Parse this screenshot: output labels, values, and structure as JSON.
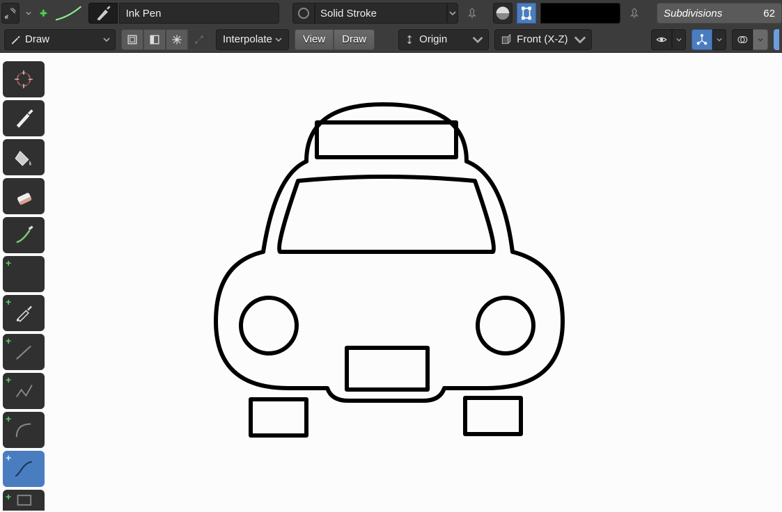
{
  "brush": {
    "name": "Ink Pen"
  },
  "material": {
    "name": "Solid Stroke"
  },
  "subdivisions": {
    "label": "Subdivisions",
    "value": "62"
  },
  "mode": {
    "label": "Draw"
  },
  "interpolate": {
    "label": "Interpolate"
  },
  "viewdraw": {
    "view": "View",
    "draw": "Draw"
  },
  "stroke_placement": {
    "origin": "Origin",
    "plane": "Front (X-Z)"
  },
  "toolbar": {
    "cursor": "cursor-tool",
    "draw": "draw-tool",
    "fill": "fill-tool",
    "erase": "erase-tool",
    "tint": "tint-tool",
    "cutter": "cutter-tool",
    "eyedropper": "eyedropper-tool",
    "line": "line-tool",
    "polyline": "polyline-tool",
    "arc": "arc-tool",
    "curve": "curve-tool",
    "box": "box-tool"
  }
}
